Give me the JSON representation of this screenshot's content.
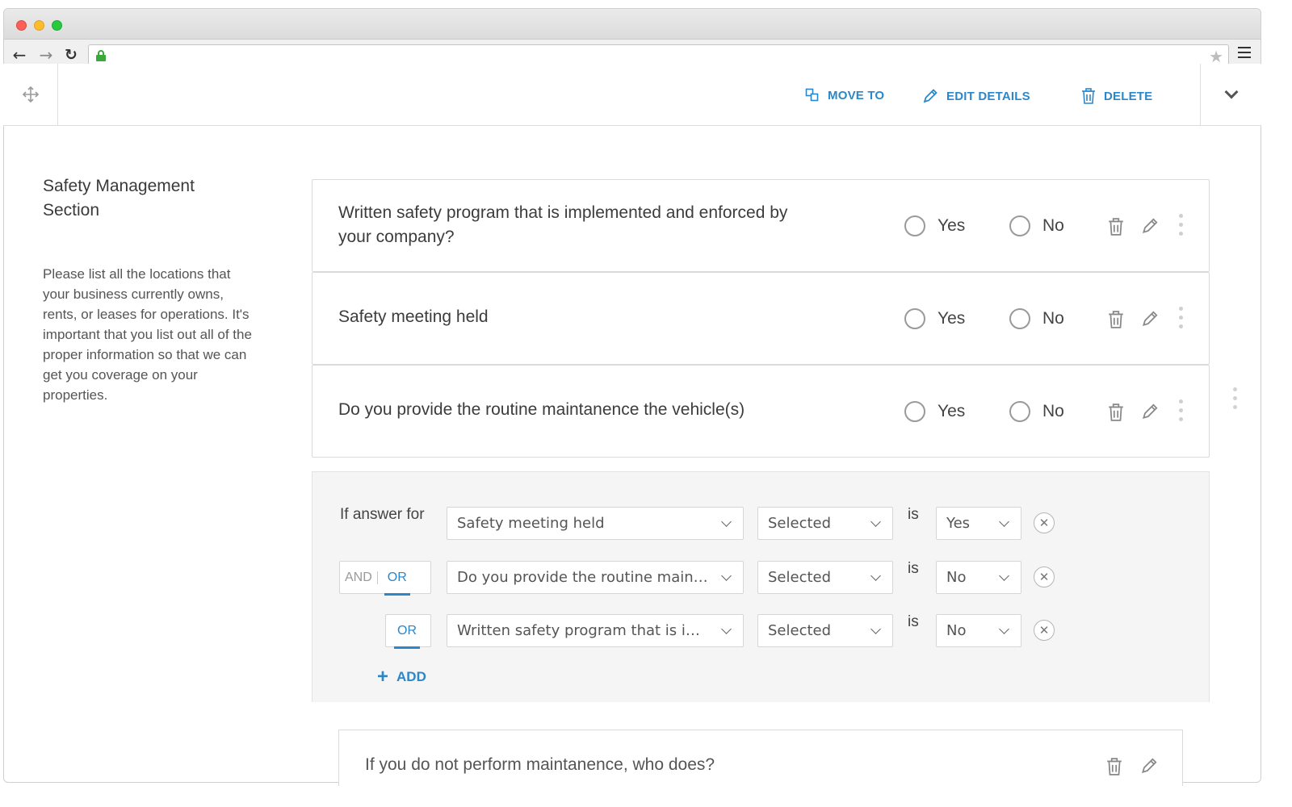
{
  "header": {
    "move_to": "MOVE TO",
    "edit_details": "EDIT DETAILS",
    "delete": "DELETE"
  },
  "section": {
    "title": "Safety Management Section",
    "description": "Please list all the locations that your business currently owns, rents, or leases for operations. It's important that you list out all of the proper information so that we can get you coverage on your properties."
  },
  "questions": [
    {
      "text": "Written safety program that is implemented and enforced by your company?",
      "yes": "Yes",
      "no": "No"
    },
    {
      "text": "Safety meeting held",
      "yes": "Yes",
      "no": "No"
    },
    {
      "text": "Do you provide the routine maintanence the vehicle(s)",
      "yes": "Yes",
      "no": "No"
    }
  ],
  "logic": {
    "if_answer_for": "If answer for",
    "is_label": "is",
    "and_label": "AND",
    "or_label": "OR",
    "add_label": "ADD",
    "rules": [
      {
        "question": "Safety meeting held",
        "condition": "Selected",
        "value": "Yes"
      },
      {
        "question": "Do you provide the routine maintanence the vehicle(s)",
        "condition": "Selected",
        "value": "No"
      },
      {
        "question": "Written safety program that is implemented and enforced by your company?",
        "condition": "Selected",
        "value": "No"
      }
    ]
  },
  "sub_question": {
    "text": "If you do not perform maintanence, who does?"
  },
  "colors": {
    "accent": "#2c87c8",
    "border": "#dadada",
    "panel_bg": "#f5f5f5"
  }
}
